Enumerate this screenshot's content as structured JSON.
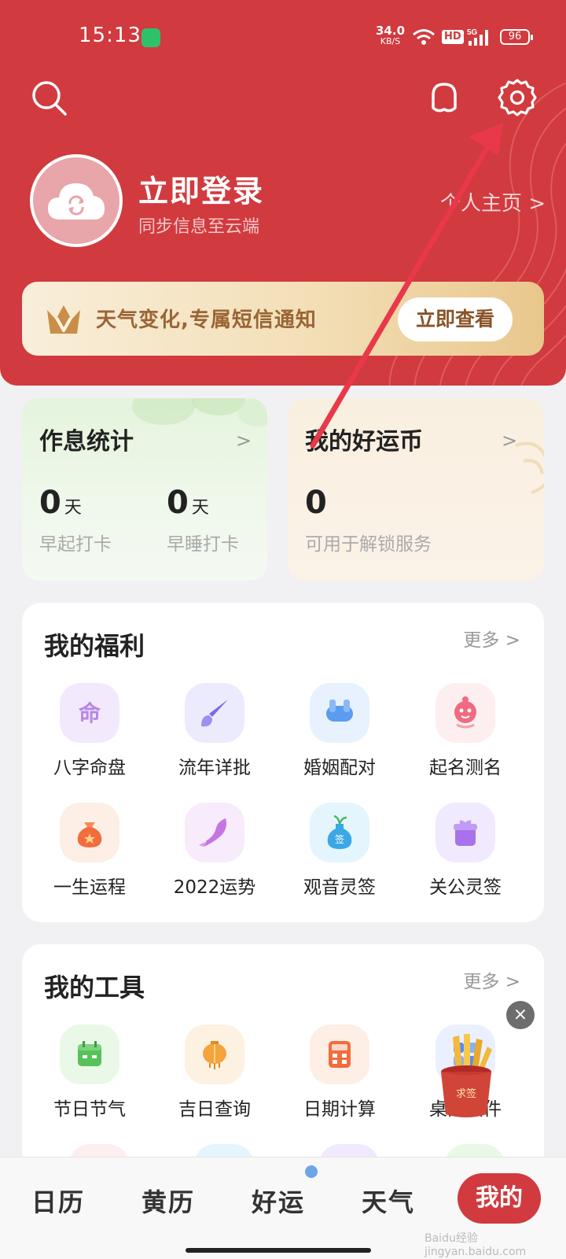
{
  "status_bar": {
    "time": "15:13",
    "speed": "34.0",
    "speed_unit": "KB/S",
    "hd": "HD",
    "network": "5G",
    "battery": "96"
  },
  "header": {
    "login_title": "立即登录",
    "login_subtitle": "同步信息至云端",
    "homepage_link": "个人主页 >",
    "vip_text": "天气变化,专属短信通知",
    "vip_button": "立即查看"
  },
  "stats": {
    "sleep": {
      "title": "作息统计",
      "early_rise_value": "0",
      "early_rise_unit": "天",
      "early_rise_label": "早起打卡",
      "early_sleep_value": "0",
      "early_sleep_unit": "天",
      "early_sleep_label": "早睡打卡"
    },
    "coins": {
      "title": "我的好运币",
      "value": "0",
      "label": "可用于解锁服务"
    }
  },
  "welfare": {
    "title": "我的福利",
    "more": "更多 >",
    "items": [
      {
        "label": "八字命盘",
        "icon": "fate-chart-icon",
        "color": "#b786e6",
        "bg": "#f3e9fd"
      },
      {
        "label": "流年详批",
        "icon": "brush-icon",
        "color": "#7b6ae8",
        "bg": "#ecebfd"
      },
      {
        "label": "婚姻配对",
        "icon": "marriage-pair-icon",
        "color": "#5a9cf0",
        "bg": "#e8f2fe"
      },
      {
        "label": "起名测名",
        "icon": "baby-face-icon",
        "color": "#f06a80",
        "bg": "#fdeef0"
      },
      {
        "label": "一生运程",
        "icon": "lucky-bag-icon",
        "color": "#f26d3d",
        "bg": "#fdeee6"
      },
      {
        "label": "2022运势",
        "icon": "dolphin-icon",
        "color": "#c575e0",
        "bg": "#f7ebfc"
      },
      {
        "label": "观音灵签",
        "icon": "vase-icon",
        "color": "#3aa8e6",
        "bg": "#e5f5fd"
      },
      {
        "label": "关公灵签",
        "icon": "gift-box-icon",
        "color": "#a772ec",
        "bg": "#f1e9fd"
      }
    ]
  },
  "tools": {
    "title": "我的工具",
    "more": "更多 >",
    "items": [
      {
        "label": "节日节气",
        "icon": "calendar-icon",
        "color": "#57c25a",
        "bg": "#eaf8e8"
      },
      {
        "label": "吉日查询",
        "icon": "lantern-icon",
        "color": "#f5a33c",
        "bg": "#fdf1e2"
      },
      {
        "label": "日期计算",
        "icon": "calculator-icon",
        "color": "#f26d3d",
        "bg": "#fdeee6"
      },
      {
        "label": "桌面插件",
        "icon": "widget-icon",
        "color": "#5a8cf0",
        "bg": "#eaf0fd"
      }
    ]
  },
  "float_widget": {
    "close": "×",
    "label": "求签"
  },
  "tabbar": {
    "tabs": [
      "日历",
      "黄历",
      "好运",
      "天气"
    ],
    "mine": "我的"
  },
  "watermark": "Baidu经验 jingyan.baidu.com"
}
